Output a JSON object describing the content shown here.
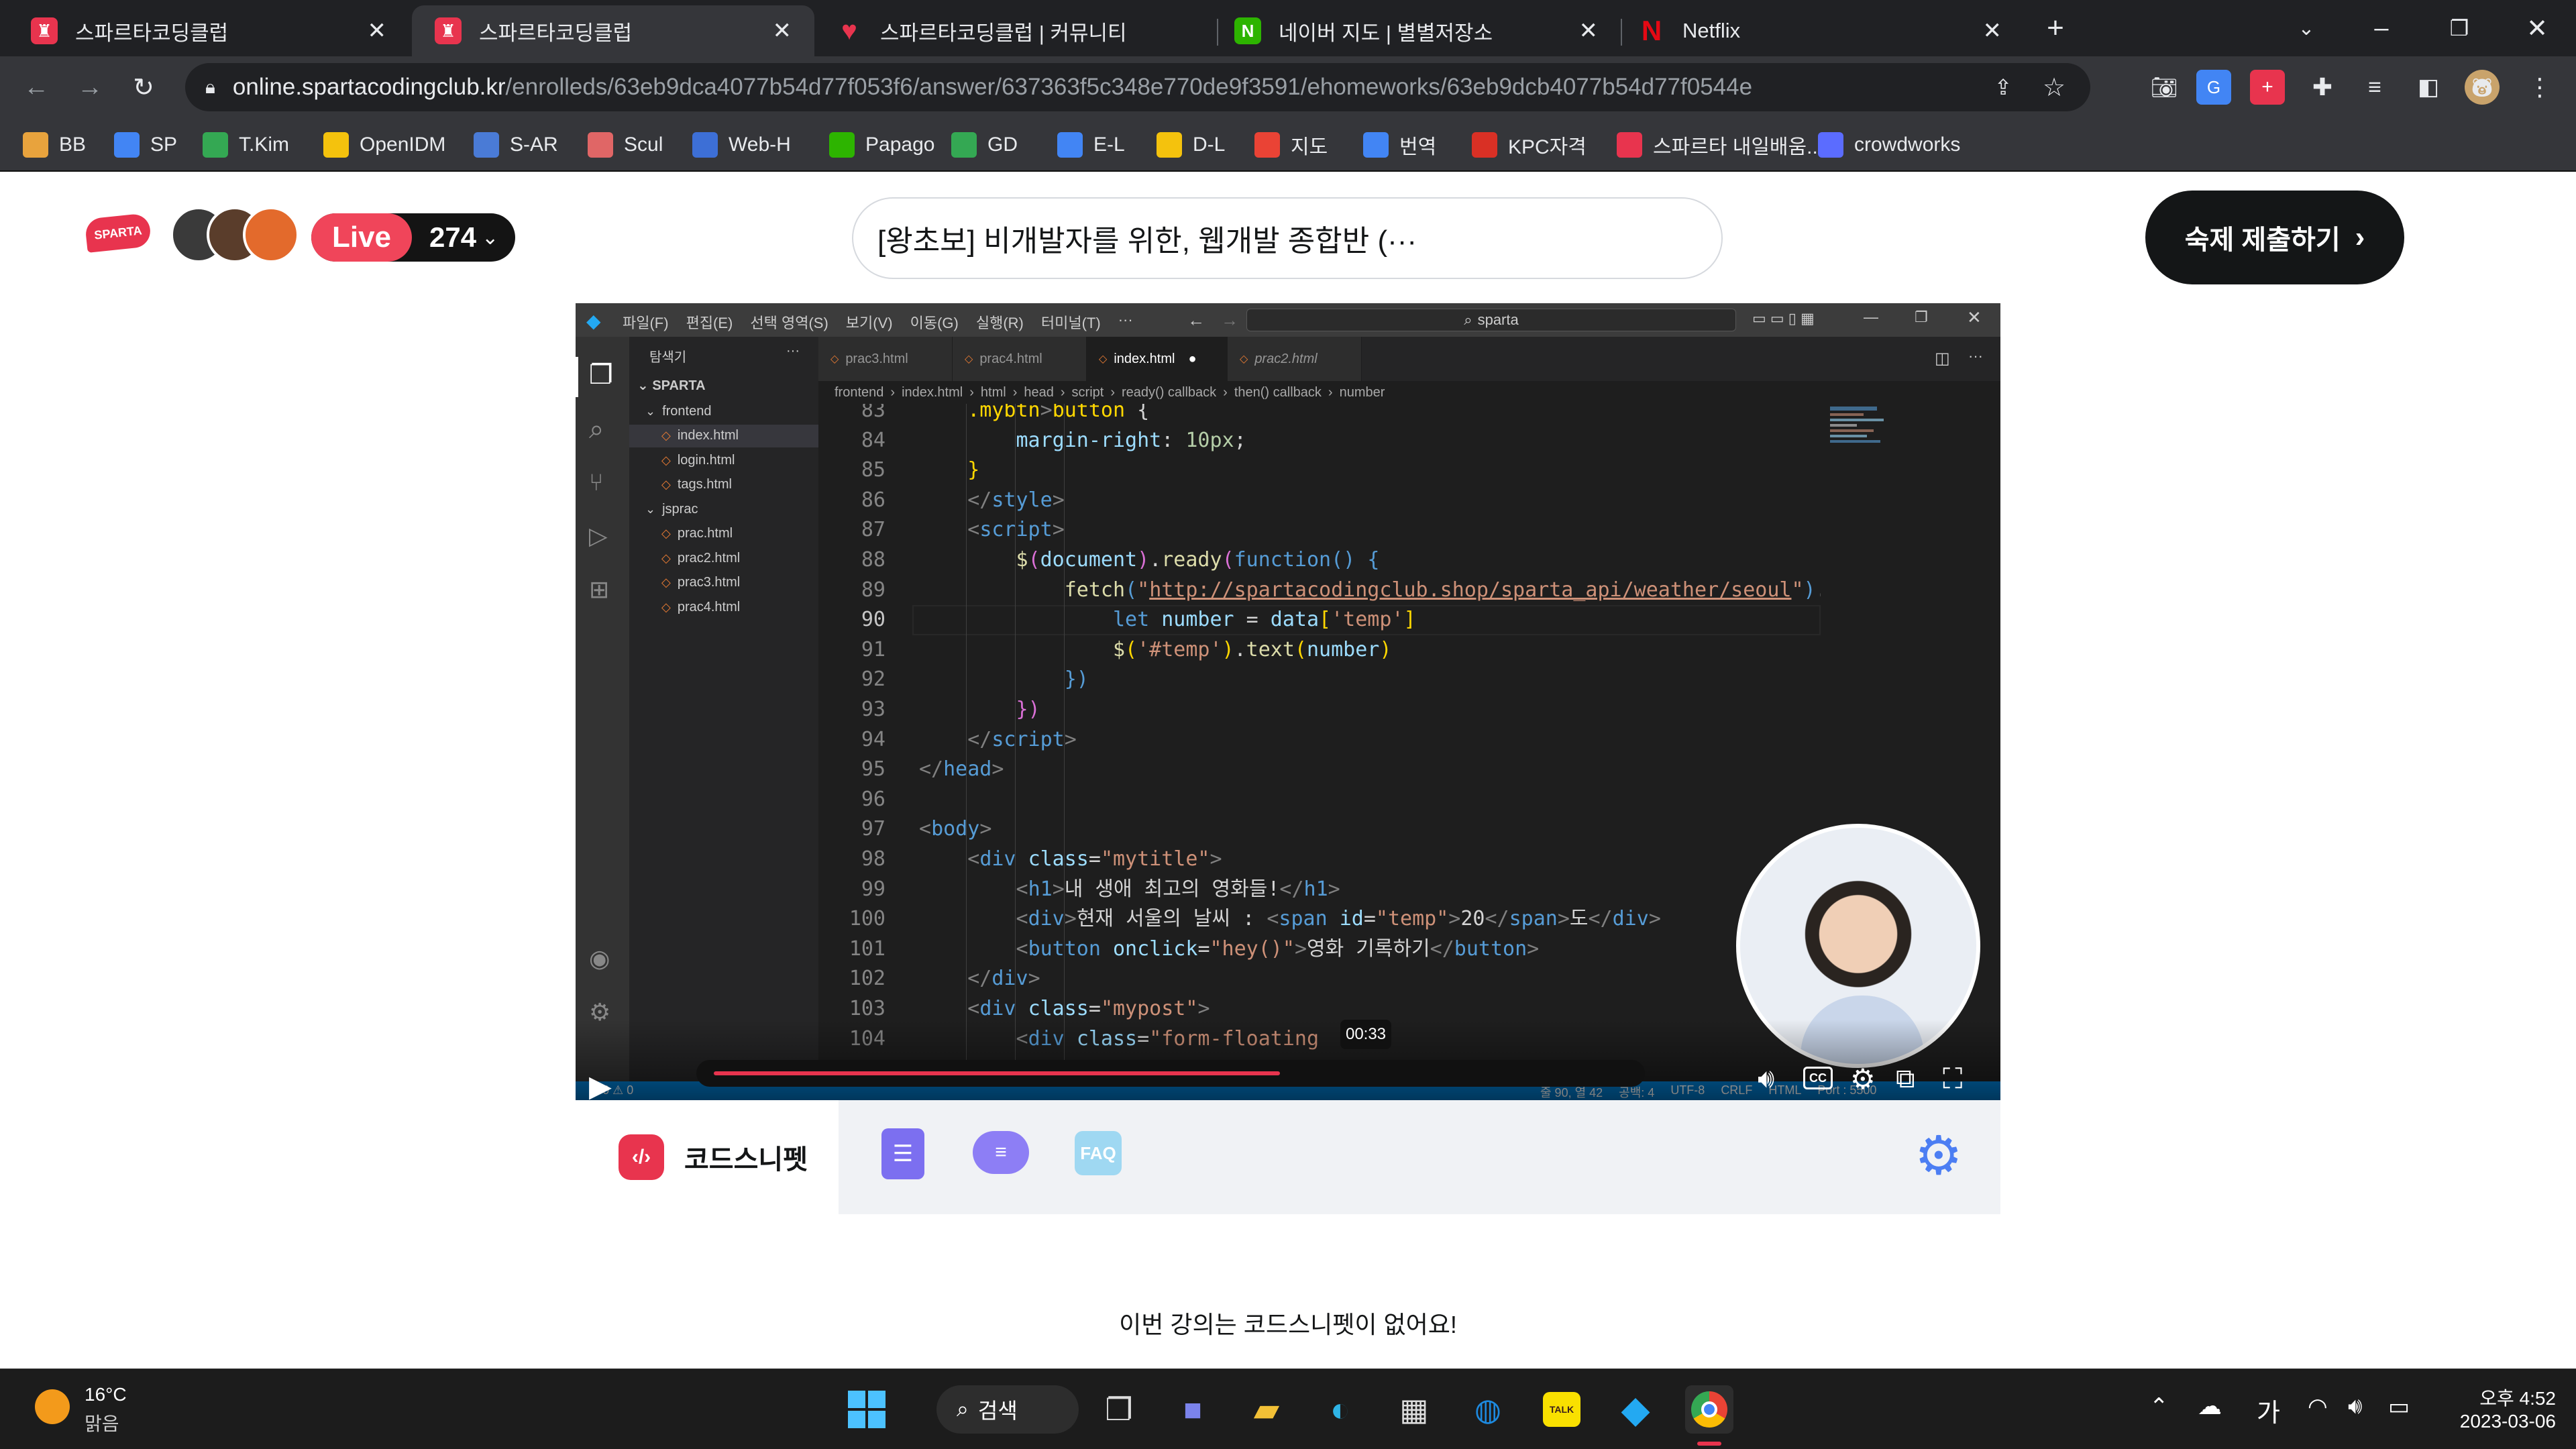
{
  "browser": {
    "tabs": [
      {
        "title": "스파르타코딩클럽",
        "active": false
      },
      {
        "title": "스파르타코딩클럽",
        "active": true
      },
      {
        "title": "스파르타코딩클럽 | 커뮤니티",
        "active": false
      },
      {
        "title": "네이버 지도 | 별별저장소",
        "active": false
      },
      {
        "title": "Netflix",
        "active": false
      }
    ],
    "url_host": "online.spartacodingclub.kr",
    "url_path": "/enrolleds/63eb9dca4077b54d77f053f6/answer/637363f5c348e770de9f3591/ehomeworks/63eb9dcb4077b54d77f0544e",
    "bookmarks": [
      {
        "label": "BB",
        "color": "#e8a33d"
      },
      {
        "label": "SP",
        "color": "#4285f4"
      },
      {
        "label": "T.Kim",
        "color": "#34a853"
      },
      {
        "label": "OpenIDM",
        "color": "#f4c20d"
      },
      {
        "label": "S-AR",
        "color": "#4a7bd6"
      },
      {
        "label": "Scul",
        "color": "#e06666"
      },
      {
        "label": "Web-H",
        "color": "#3d6fd6"
      },
      {
        "label": "Papago",
        "color": "#2db400"
      },
      {
        "label": "GD",
        "color": "#34a853"
      },
      {
        "label": "E-L",
        "color": "#4285f4"
      },
      {
        "label": "D-L",
        "color": "#f4c20d"
      },
      {
        "label": "지도",
        "color": "#ea4335"
      },
      {
        "label": "번역",
        "color": "#4285f4"
      },
      {
        "label": "KPC자격",
        "color": "#d93025"
      },
      {
        "label": "스파르타 내일배움...",
        "color": "#e8344e"
      },
      {
        "label": "crowdworks",
        "color": "#5b6cff"
      }
    ]
  },
  "header": {
    "logo": "SPARTA",
    "live_label": "Live",
    "live_count": "274",
    "course_title": "[왕초보] 비개발자를 위한, 웹개발 종합반 (···",
    "submit_button": "숙제 제출하기"
  },
  "vscode": {
    "menu": [
      "파일(F)",
      "편집(E)",
      "선택 영역(S)",
      "보기(V)",
      "이동(G)",
      "실행(R)",
      "터미널(T)",
      "···"
    ],
    "search": "sparta",
    "explorer_title": "탐색기",
    "root": "SPARTA",
    "tree": [
      {
        "name": "frontend",
        "folder": true,
        "indent": 1
      },
      {
        "name": "index.html",
        "folder": false,
        "indent": 2,
        "selected": true
      },
      {
        "name": "login.html",
        "folder": false,
        "indent": 2
      },
      {
        "name": "tags.html",
        "folder": false,
        "indent": 2
      },
      {
        "name": "jsprac",
        "folder": true,
        "indent": 1
      },
      {
        "name": "prac.html",
        "folder": false,
        "indent": 2
      },
      {
        "name": "prac2.html",
        "folder": false,
        "indent": 2
      },
      {
        "name": "prac3.html",
        "folder": false,
        "indent": 2
      },
      {
        "name": "prac4.html",
        "folder": false,
        "indent": 2
      }
    ],
    "tabs": [
      "prac3.html",
      "prac4.html",
      "index.html",
      "prac2.html"
    ],
    "active_tab": "index.html",
    "breadcrumbs": [
      "frontend",
      "index.html",
      "html",
      "head",
      "script",
      "ready() callback",
      "then() callback",
      "number"
    ],
    "lines": [
      {
        "n": "83",
        "html": "    <span class=\"y\">.mybtn</span><span class=\"p\">&gt;</span><span class=\"y\">button</span> {"
      },
      {
        "n": "84",
        "html": "        <span class=\"v\">margin-right</span>: <span class=\"n\">10px</span>;"
      },
      {
        "n": "85",
        "html": "    <span class=\"y\">}</span>"
      },
      {
        "n": "86",
        "html": "    <span class=\"p\">&lt;/</span><span class=\"t\">style</span><span class=\"p\">&gt;</span>"
      },
      {
        "n": "87",
        "html": "    <span class=\"p\">&lt;</span><span class=\"t\">script</span><span class=\"p\">&gt;</span>"
      },
      {
        "n": "88",
        "html": "        <span class=\"f\">$</span><span class=\"m\">(</span><span class=\"v\">document</span><span class=\"m\">)</span>.<span class=\"f\">ready</span><span class=\"m\">(</span><span class=\"k\">function</span><span class=\"k\">()</span> <span class=\"k\">{</span>"
      },
      {
        "n": "89",
        "html": "            <span class=\"f\">fetch</span><span class=\"k\">(</span><span class=\"s\">\"<u>http://spartacodingclub.shop/sparta_api/weather/seoul</u>\"</span><span class=\"k\">)</span>.<span class=\"f\">then</span><span class=\"k\">(</span><span class=\"v\">re</span>"
      },
      {
        "n": "90",
        "html": "                <span class=\"k\">let</span> <span class=\"v\">number</span> = <span class=\"v\">data</span><span class=\"y\">[</span><span class=\"s\">'temp'</span><span class=\"y\">]</span>"
      },
      {
        "n": "91",
        "html": "                <span class=\"f\">$</span><span class=\"y\">(</span><span class=\"s\">'#temp'</span><span class=\"y\">)</span>.<span class=\"f\">text</span><span class=\"y\">(</span><span class=\"v\">number</span><span class=\"y\">)</span>"
      },
      {
        "n": "92",
        "html": "            <span class=\"k\">})</span>"
      },
      {
        "n": "93",
        "html": "        <span class=\"m\">})</span>"
      },
      {
        "n": "94",
        "html": "    <span class=\"p\">&lt;/</span><span class=\"t\">script</span><span class=\"p\">&gt;</span>"
      },
      {
        "n": "95",
        "html": "<span class=\"p\">&lt;/</span><span class=\"t\">head</span><span class=\"p\">&gt;</span>"
      },
      {
        "n": "96",
        "html": ""
      },
      {
        "n": "97",
        "html": "<span class=\"p\">&lt;</span><span class=\"t\">body</span><span class=\"p\">&gt;</span>"
      },
      {
        "n": "98",
        "html": "    <span class=\"p\">&lt;</span><span class=\"t\">div</span> <span class=\"v\">class</span>=<span class=\"s\">\"mytitle\"</span><span class=\"p\">&gt;</span>"
      },
      {
        "n": "99",
        "html": "        <span class=\"p\">&lt;</span><span class=\"t\">h1</span><span class=\"p\">&gt;</span>내 생애 최고의 영화들!<span class=\"p\">&lt;/</span><span class=\"t\">h1</span><span class=\"p\">&gt;</span>"
      },
      {
        "n": "100",
        "html": "        <span class=\"p\">&lt;</span><span class=\"t\">div</span><span class=\"p\">&gt;</span>현재 서울의 날씨 : <span class=\"p\">&lt;</span><span class=\"t\">span</span> <span class=\"v\">id</span>=<span class=\"s\">\"temp\"</span><span class=\"p\">&gt;</span>20<span class=\"p\">&lt;/</span><span class=\"t\">span</span><span class=\"p\">&gt;</span>도<span class=\"p\">&lt;/</span><span class=\"t\">div</span><span class=\"p\">&gt;</span>"
      },
      {
        "n": "101",
        "html": "        <span class=\"p\">&lt;</span><span class=\"t\">button</span> <span class=\"v\">onclick</span>=<span class=\"s\">\"hey()\"</span><span class=\"p\">&gt;</span>영화 기록하기<span class=\"p\">&lt;/</span><span class=\"t\">button</span><span class=\"p\">&gt;</span>"
      },
      {
        "n": "102",
        "html": "    <span class=\"p\">&lt;/</span><span class=\"t\">div</span><span class=\"p\">&gt;</span>"
      },
      {
        "n": "103",
        "html": "    <span class=\"p\">&lt;</span><span class=\"t\">div</span> <span class=\"v\">class</span>=<span class=\"s\">\"mypost\"</span><span class=\"p\">&gt;</span>"
      },
      {
        "n": "104",
        "html": "        <span class=\"p\">&lt;</span><span class=\"t\">div</span> <span class=\"v\">class</span>=<span class=\"s\">\"form-floating</span>"
      }
    ],
    "current_line": "90",
    "status_right": [
      "줄 90, 열 42",
      "공백: 4",
      "UTF-8",
      "CRLF",
      "HTML",
      "Port : 5500"
    ]
  },
  "video": {
    "time_tooltip": "00:33",
    "progress": 0.62
  },
  "panel": {
    "active_tab": "코드스니펫",
    "faq_label": "FAQ",
    "empty_message": "이번 강의는 코드스니펫이 없어요!"
  },
  "taskbar": {
    "weather_temp": "16°C",
    "weather_desc": "맑음",
    "search_label": "검색",
    "ime": "가",
    "time": "오후 4:52",
    "date": "2023-03-06"
  },
  "colors": {
    "sparta_red": "#e8344e",
    "live_red": "#f0455a",
    "vscode_blue": "#007acc"
  }
}
